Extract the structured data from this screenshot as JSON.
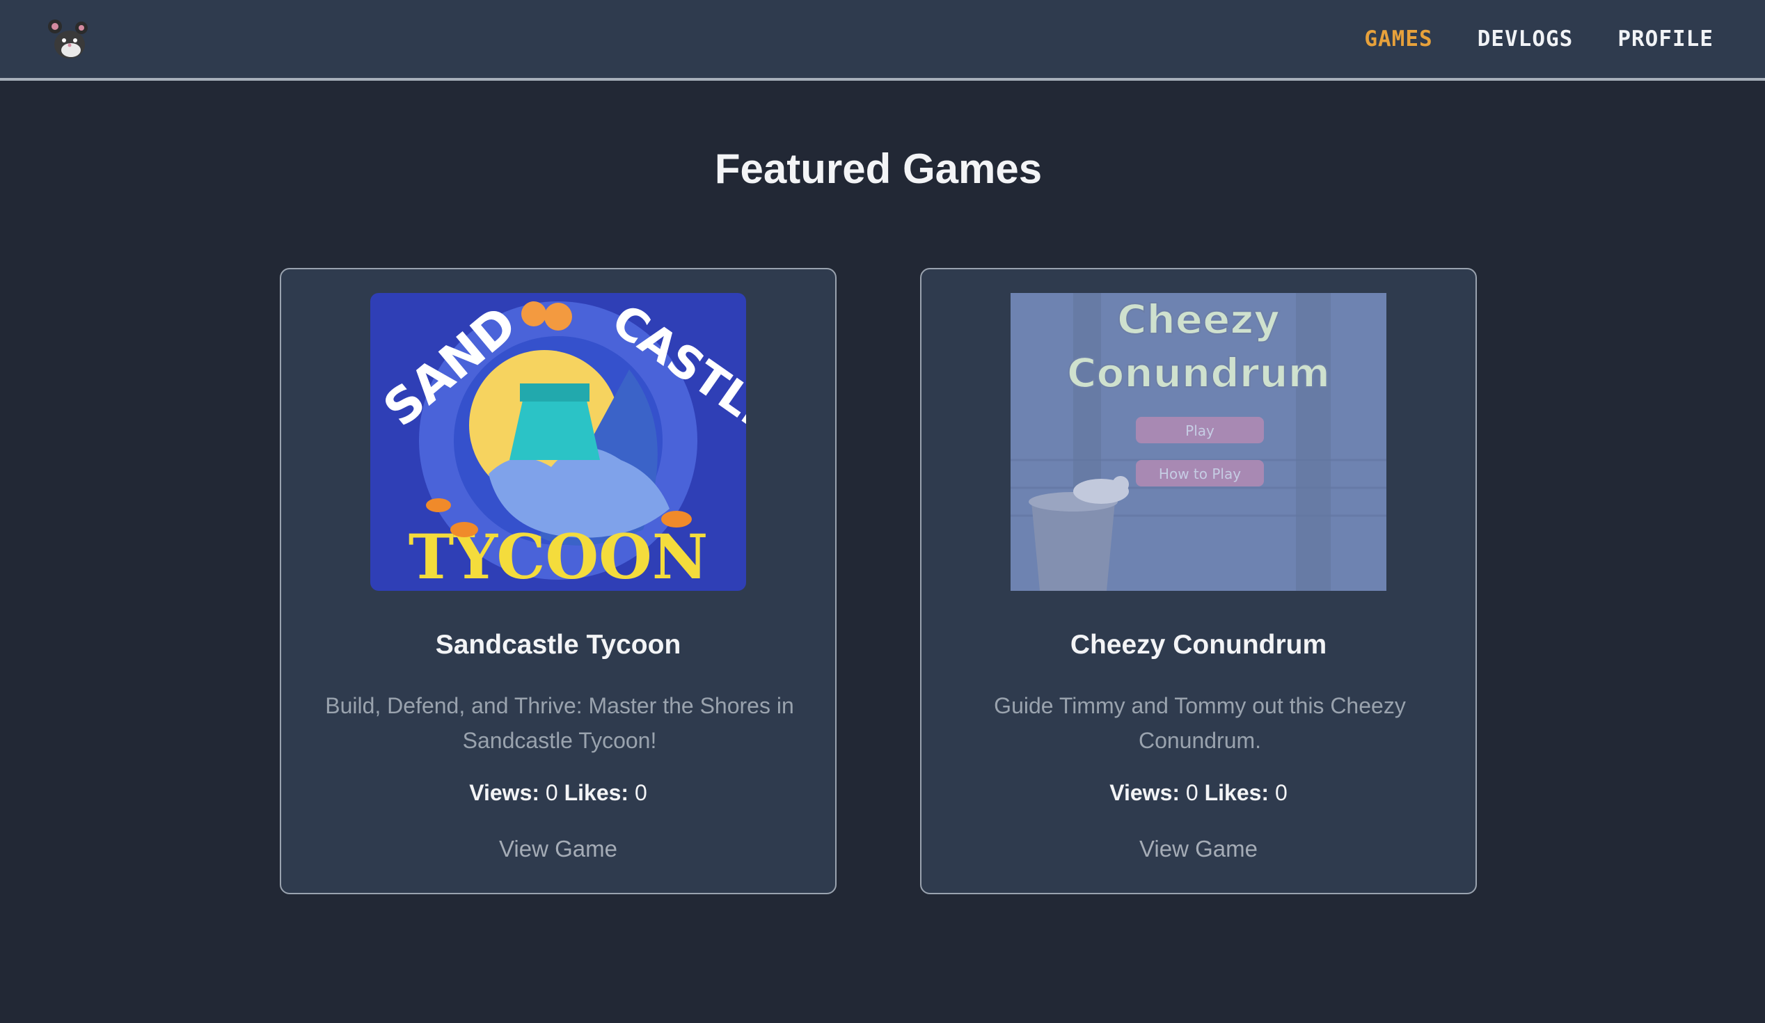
{
  "nav": {
    "logo_icon": "rat-mascot-logo-icon",
    "links": [
      "GAMES",
      "DEVLOGS",
      "PROFILE"
    ],
    "active": "GAMES",
    "accent_color": "#e7a13b"
  },
  "page": {
    "title": "Featured Games"
  },
  "games": [
    {
      "title": "Sandcastle Tycoon",
      "description": "Build, Defend, and Thrive: Master the Shores in Sandcastle Tycoon!",
      "views_label": "Views:",
      "views": "0",
      "likes_label": "Likes:",
      "likes": "0",
      "link_label": "View Game",
      "thumbnail_text": [
        "SAND",
        "CASTLE",
        "TYCOON"
      ]
    },
    {
      "title": "Cheezy Conundrum",
      "description": "Guide Timmy and Tommy out this Cheezy Conundrum.",
      "views_label": "Views:",
      "views": "0",
      "likes_label": "Likes:",
      "likes": "0",
      "link_label": "View Game",
      "thumbnail_text": [
        "Cheezy",
        "Conundrum",
        "Play",
        "How to Play"
      ]
    }
  ]
}
